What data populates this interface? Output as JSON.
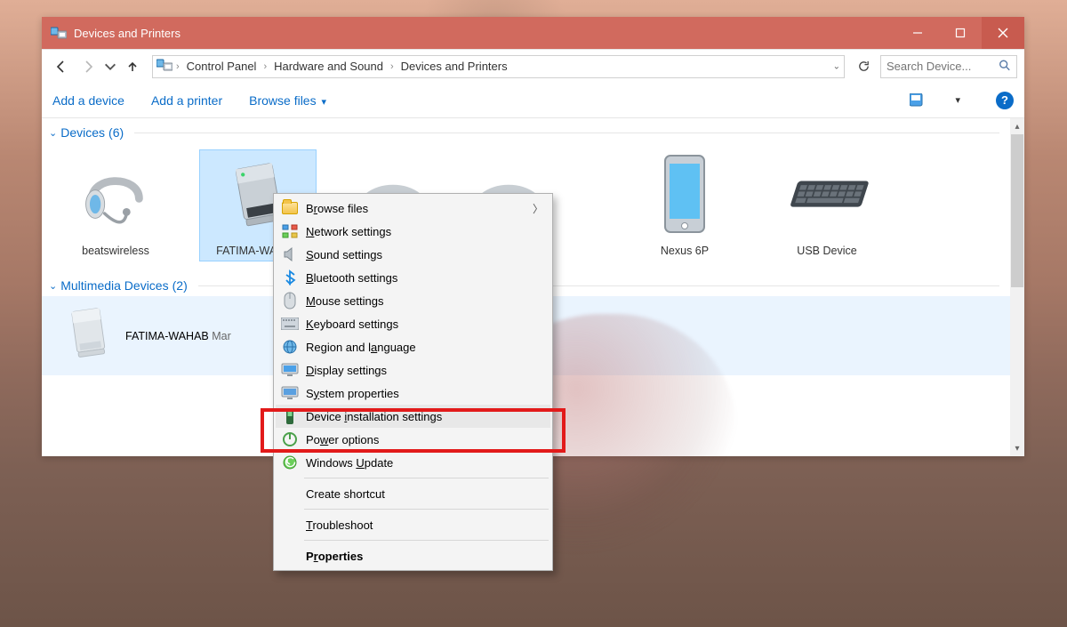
{
  "window": {
    "title": "Devices and Printers"
  },
  "breadcrumb": {
    "items": [
      "Control Panel",
      "Hardware and Sound",
      "Devices and Printers"
    ]
  },
  "search": {
    "placeholder": "Search Device..."
  },
  "toolbar": {
    "add_device": "Add a device",
    "add_printer": "Add a printer",
    "browse_files": "Browse files"
  },
  "sections": {
    "devices": {
      "title": "Devices",
      "count": "6"
    },
    "multimedia": {
      "title": "Multimedia Devices",
      "count": "2"
    }
  },
  "devices": [
    {
      "name": "beatswireless"
    },
    {
      "name": "FATIMA-WAHAB"
    },
    {
      "name": ""
    },
    {
      "name": ""
    },
    {
      "name": "Nexus 6P"
    },
    {
      "name": "USB Device"
    }
  ],
  "multimedia": [
    {
      "name": "FATIMA-WAHAB",
      "role": "Mar"
    }
  ],
  "context_menu": {
    "items": [
      {
        "label": "B<u>r</u>owse files",
        "icon": "folder",
        "arrow": true
      },
      {
        "label": "<u>N</u>etwork settings",
        "icon": "network"
      },
      {
        "label": "<u>S</u>ound settings",
        "icon": "sound"
      },
      {
        "label": "<u>B</u>luetooth settings",
        "icon": "bluetooth"
      },
      {
        "label": "<u>M</u>ouse settings",
        "icon": "mouse"
      },
      {
        "label": "<u>K</u>eyboard settings",
        "icon": "keyboard"
      },
      {
        "label": "Region and l<u>a</u>nguage",
        "icon": "region"
      },
      {
        "label": "<u>D</u>isplay settings",
        "icon": "display"
      },
      {
        "label": "S<u>y</u>stem properties",
        "icon": "system"
      },
      {
        "label": "Device <u>i</u>nstallation settings",
        "icon": "devinstall",
        "highlight": true
      },
      {
        "label": "Po<u>w</u>er options",
        "icon": "power"
      },
      {
        "label": "Windows <u>U</u>pdate",
        "icon": "update"
      },
      {
        "sep": true
      },
      {
        "label": "Create shortcut"
      },
      {
        "sep": true
      },
      {
        "label": "<u>T</u>roubleshoot"
      },
      {
        "sep": true
      },
      {
        "label": "P<u>r</u>operties",
        "bold": true
      }
    ]
  },
  "help_glyph": "?"
}
